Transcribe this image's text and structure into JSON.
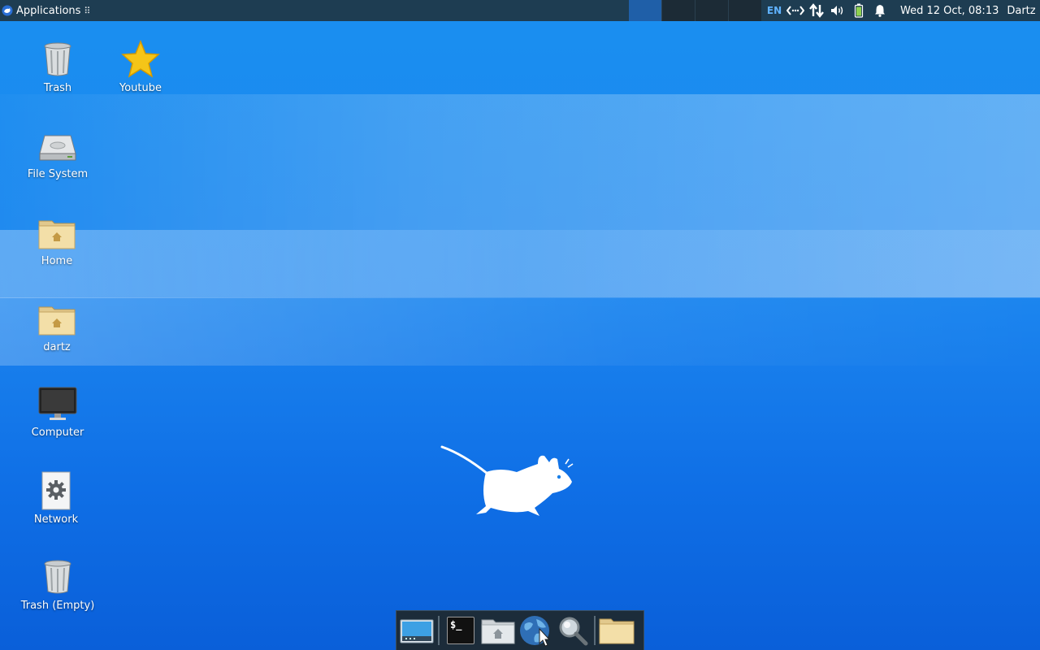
{
  "top_panel": {
    "app_menu_label": "Applications",
    "app_menu_suffix": "⠿",
    "language": "EN",
    "clock": "Wed 12 Oct, 08:13",
    "user": "Dartz"
  },
  "desktop_icons": [
    {
      "label": "Trash",
      "icon": "trash-full-icon"
    },
    {
      "label": "Youtube",
      "icon": "star-bookmark-icon"
    },
    {
      "label": "File System",
      "icon": "hard-drive-icon"
    },
    {
      "label": "Home",
      "icon": "home-folder-icon"
    },
    {
      "label": "dartz",
      "icon": "home-folder-icon"
    },
    {
      "label": "Computer",
      "icon": "monitor-icon"
    },
    {
      "label": "Network",
      "icon": "network-gear-icon"
    },
    {
      "label": "Trash (Empty)",
      "icon": "trash-empty-icon"
    }
  ],
  "dock": {
    "launchers": [
      "show-desktop-icon",
      "terminal-icon",
      "home-folder-icon",
      "web-browser-icon",
      "search-icon",
      "folder-icon"
    ],
    "terminal_prompt": "$_"
  },
  "colors": {
    "panel": "#1e3d52",
    "desktop": "#1a8ff0",
    "accent": "#5fb2ff"
  }
}
